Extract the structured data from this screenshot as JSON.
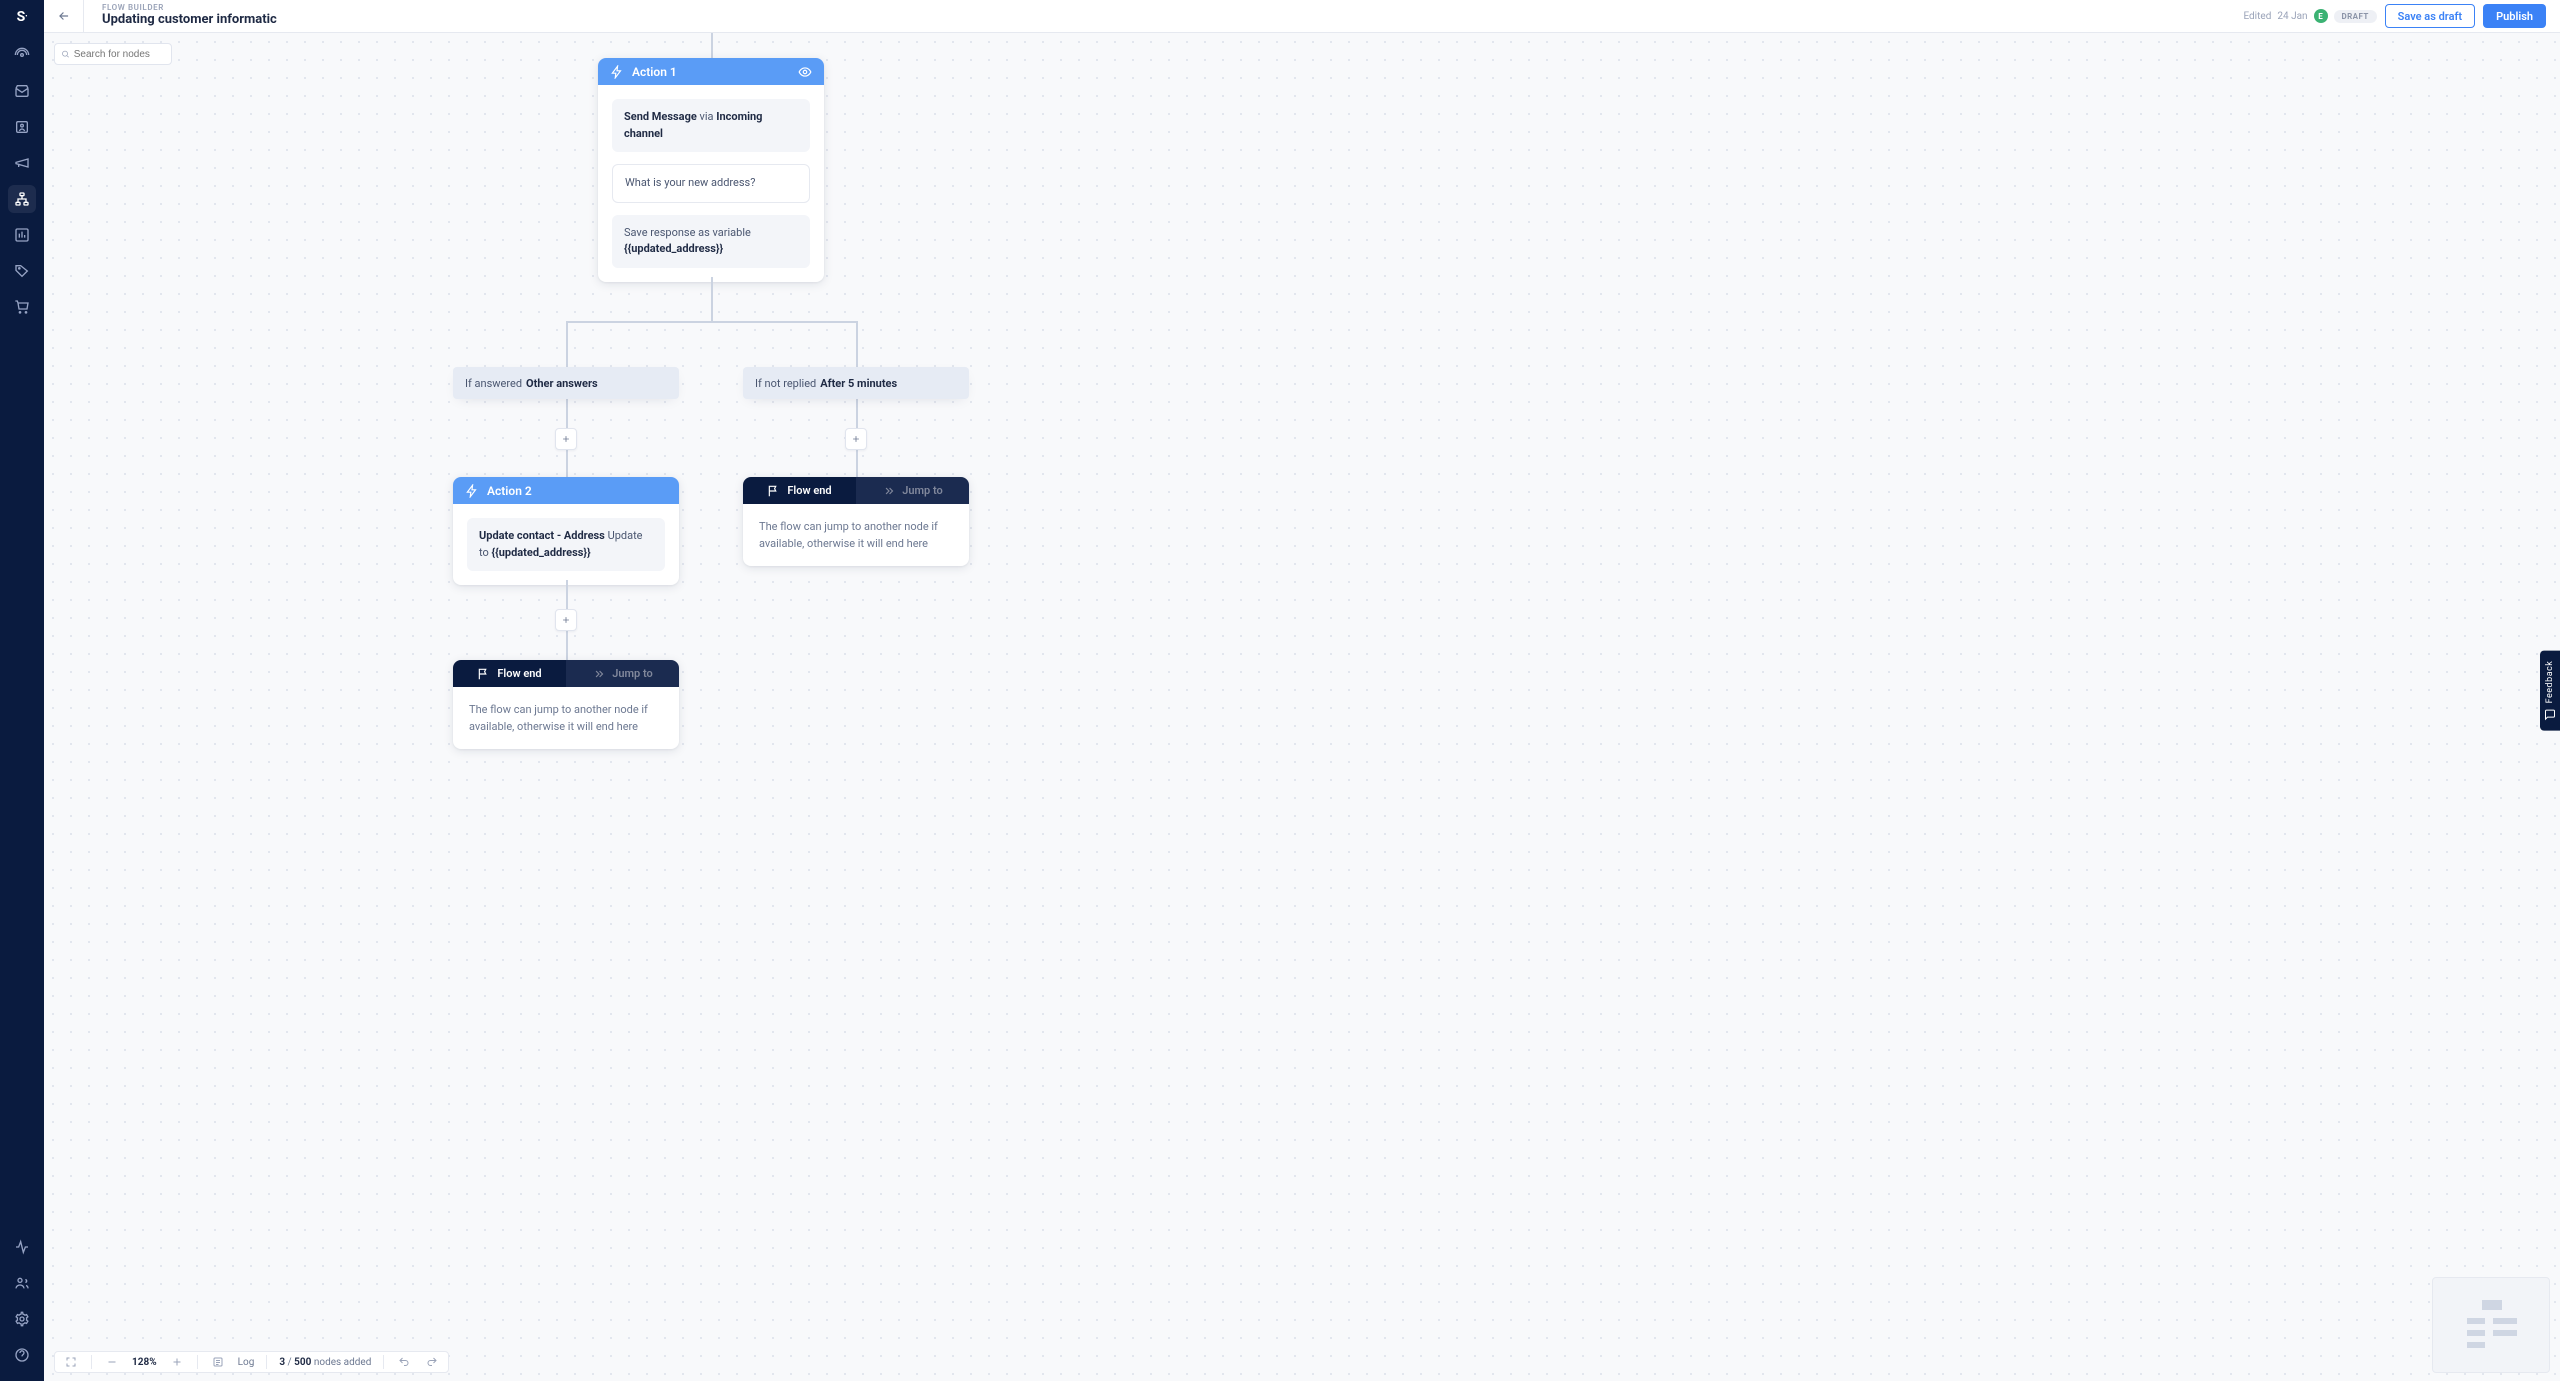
{
  "header": {
    "eyebrow": "FLOW BUILDER",
    "title": "Updating customer informatic",
    "edited_prefix": "Edited",
    "edited_date": "24 Jan",
    "avatar_initial": "E",
    "status": "DRAFT",
    "save_draft_label": "Save as draft",
    "publish_label": "Publish"
  },
  "search": {
    "placeholder": "Search for nodes"
  },
  "bottombar": {
    "zoom": "128%",
    "log_label": "Log",
    "nodes_used": "3",
    "nodes_sep": " / ",
    "nodes_total": "500",
    "nodes_suffix": " nodes added"
  },
  "feedback": {
    "label": "Feedback"
  },
  "nodes": {
    "action1": {
      "title": "Action 1",
      "send_strong1": "Send Message",
      "send_via": " via ",
      "send_strong2": "Incoming channel",
      "message": "What is your new address?",
      "save_prefix": "Save response as variable ",
      "save_var": "{{updated_address}}"
    },
    "branch_left": {
      "prefix": "If answered",
      "strong": "Other answers"
    },
    "branch_right": {
      "prefix": "If not replied",
      "strong": "After 5 minutes"
    },
    "action2": {
      "title": "Action 2",
      "upd_strong": "Update contact - Address",
      "upd_mid": " Update to ",
      "upd_var": "{{updated_address}}"
    },
    "flowend": {
      "tab_end": "Flow end",
      "tab_jump": "Jump to",
      "body": "The flow can jump to another node if available, otherwise it will end here"
    }
  }
}
